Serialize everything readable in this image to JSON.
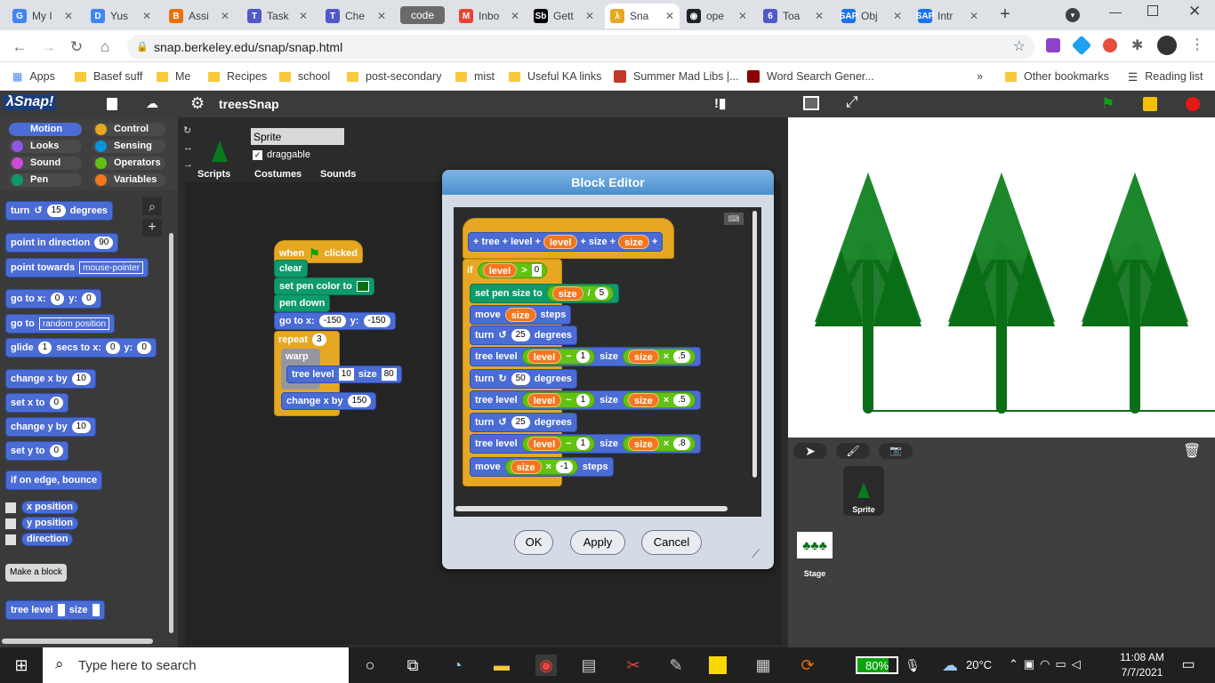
{
  "browser": {
    "tabs": [
      {
        "label": "My I",
        "color": "#4285f4",
        "icon": "G"
      },
      {
        "label": "Yus",
        "color": "#4285f4",
        "icon": "D"
      },
      {
        "label": "Assi",
        "color": "#e8710a",
        "icon": "B"
      },
      {
        "label": "Task",
        "color": "#5059c9",
        "icon": "T"
      },
      {
        "label": "Che",
        "color": "#5059c9",
        "icon": "T"
      },
      {
        "label": "code",
        "color": "#666666",
        "icon": ""
      },
      {
        "label": "Inbo",
        "color": "#ea4335",
        "icon": "M"
      },
      {
        "label": "Gett",
        "color": "#000000",
        "icon": "Sb"
      },
      {
        "label": "Sna",
        "color": "#e6a822",
        "icon": "λ"
      },
      {
        "label": "ope",
        "color": "#202124",
        "icon": "◉"
      },
      {
        "label": "Toa",
        "color": "#5059c9",
        "icon": "6"
      },
      {
        "label": "Obj",
        "color": "#1a73e8",
        "icon": "SAP"
      },
      {
        "label": "Intr",
        "color": "#1a73e8",
        "icon": "SAP"
      }
    ],
    "url": "snap.berkeley.edu/snap/snap.html",
    "bookmarks": [
      "Apps",
      "Basef suff",
      "Me",
      "Recipes",
      "school",
      "post-secondary",
      "mist",
      "Useful KA links",
      "Summer Mad Libs |...",
      "Word Search Gener..."
    ],
    "other_bookmarks": "Other bookmarks",
    "reading_list": "Reading list"
  },
  "snap": {
    "project_name": "treesSnap",
    "categories": [
      [
        "Motion",
        "#4a6cd4"
      ],
      [
        "Control",
        "#e6a822"
      ],
      [
        "Looks",
        "#8f56e3"
      ],
      [
        "Sensing",
        "#0494dc"
      ],
      [
        "Sound",
        "#cf4ad9"
      ],
      [
        "Operators",
        "#62c213"
      ],
      [
        "Pen",
        "#0e9a6c"
      ],
      [
        "Variables",
        "#f3761d"
      ]
    ],
    "sprite_name": "Sprite",
    "draggable_label": "draggable",
    "tabs": [
      "Scripts",
      "Costumes",
      "Sounds"
    ],
    "palette": {
      "turn": "turn",
      "turn_val": "15",
      "degrees": "degrees",
      "point_dir": "point in direction",
      "point_dir_val": "90",
      "point_towards": "point towards",
      "point_towards_val": "mouse-pointer",
      "goto_xy": "go to x:",
      "goto_x": "0",
      "y": "y:",
      "goto_y": "0",
      "goto": "go to",
      "goto_val": "random position",
      "glide": "glide",
      "glide_secs": "1",
      "secs_to_x": "secs to x:",
      "glide_x": "0",
      "glide_y": "0",
      "change_x": "change x by",
      "change_x_val": "10",
      "set_x": "set x to",
      "set_x_val": "0",
      "change_y": "change y by",
      "change_y_val": "10",
      "set_y": "set y to",
      "set_y_val": "0",
      "bounce": "if on edge, bounce",
      "x_position": "x position",
      "y_position": "y position",
      "direction": "direction",
      "make_block": "Make a block",
      "tree_block": "tree level",
      "size": "size"
    },
    "script": {
      "when": "when",
      "clicked": "clicked",
      "clear": "clear",
      "set_pen_color": "set pen color to",
      "pen_down": "pen down",
      "goto": "go to x:",
      "goto_x": "-150",
      "y": "y:",
      "goto_y": "-150",
      "repeat": "repeat",
      "repeat_val": "3",
      "warp": "warp",
      "tree_level": "tree level",
      "tree_level_val": "10",
      "size": "size",
      "size_val": "80",
      "change_x": "change x by",
      "change_x_val": "150"
    },
    "block_editor": {
      "title": "Block Editor",
      "hat": [
        "+",
        "tree",
        "+",
        "level",
        "+",
        "level",
        "+",
        "size",
        "+",
        "size",
        "+"
      ],
      "if": "if",
      "level": "level",
      "gt": ">",
      "zero": "0",
      "set_pen_size": "set pen size to",
      "size": "size",
      "div": "/",
      "five": "5",
      "move": "move",
      "steps": "steps",
      "turn": "turn",
      "deg25": "25",
      "degrees": "degrees",
      "tree_level": "tree level",
      "minus": "−",
      "one": "1",
      "times": "×",
      "half": ".5",
      "deg50": "50",
      "eight": ".8",
      "neg1": "-1",
      "ok": "OK",
      "apply": "Apply",
      "cancel": "Cancel"
    },
    "stage_sprite_label": "Sprite",
    "stage_label": "Stage"
  },
  "taskbar": {
    "search_placeholder": "Type here to search",
    "battery": "80%",
    "weather": "20°C",
    "time": "11:08 AM",
    "date": "7/7/2021"
  }
}
